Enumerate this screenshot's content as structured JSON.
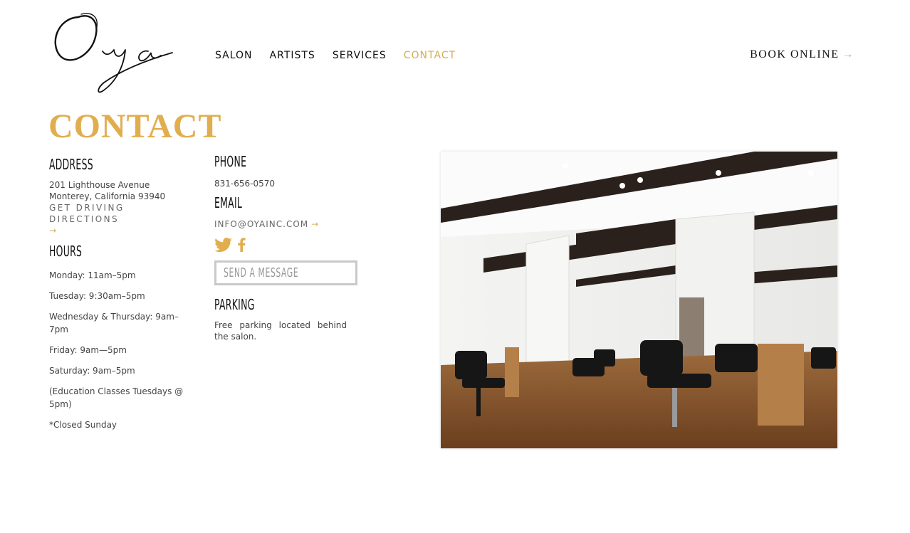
{
  "logo": {
    "text": "Oya"
  },
  "nav": {
    "items": [
      {
        "label": "SALON"
      },
      {
        "label": "ARTISTS"
      },
      {
        "label": "SERVICES"
      },
      {
        "label": "CONTACT",
        "active": true
      }
    ]
  },
  "book_online": {
    "label": "BOOK ONLINE",
    "arrow": "→"
  },
  "page_title": "CONTACT",
  "address": {
    "heading": "ADDRESS",
    "line1": "201 Lighthouse Avenue",
    "line2": "Monterey, California 93940",
    "directions": "GET DRIVING DIRECTIONS",
    "arrow": "→"
  },
  "hours": {
    "heading": "HOURS",
    "items": [
      "Monday: 11am–5pm",
      "Tuesday: 9:30am–5pm",
      "Wednesday & Thursday: 9am–7pm",
      "Friday: 9am—5pm",
      "Saturday: 9am–5pm",
      "(Education Classes Tuesdays @ 5pm)",
      "*Closed Sunday"
    ]
  },
  "phone": {
    "heading": "PHONE",
    "value": "831-656-0570"
  },
  "email": {
    "heading": "EMAIL",
    "value": "INFO@OYAINC.COM",
    "arrow": "→"
  },
  "social": {
    "icons": [
      "twitter-icon",
      "facebook-icon"
    ]
  },
  "send_message": {
    "label": "SEND A MESSAGE"
  },
  "parking": {
    "heading": "PARKING",
    "text": "Free parking located behind the salon."
  },
  "colors": {
    "accent": "#e1ae4e",
    "text": "#111111",
    "muted": "#666666"
  }
}
